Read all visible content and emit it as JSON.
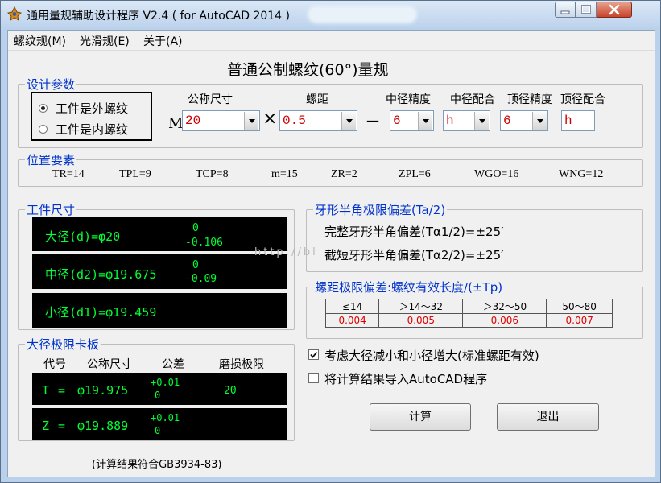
{
  "window": {
    "title": "通用量规辅助设计程序 V2.4 ( for AutoCAD 2014 )"
  },
  "menu": [
    "螺纹规(M)",
    "光滑规(E)",
    "关于(A)"
  ],
  "heading": "普通公制螺纹(60°)量规",
  "design": {
    "label": "设计参数",
    "radio_ext": "工件是外螺纹",
    "radio_int": "工件是内螺纹",
    "m_label": "M",
    "times": "×",
    "dash": "—",
    "nominal_label": "公称尺寸",
    "nominal": "20",
    "pitch_label": "螺距",
    "pitch": "0.5",
    "pd_acc_label": "中径精度",
    "pd_acc": "6",
    "pd_fit_label": "中径配合",
    "pd_fit": "h",
    "od_acc_label": "顶径精度",
    "od_acc": "6",
    "od_fit_label": "顶径配合",
    "od_fit": "h"
  },
  "position": {
    "label": "位置要素",
    "items": [
      "TR=14",
      "TPL=9",
      "TCP=8",
      "m=15",
      "ZR=2",
      "ZPL=6",
      "WGO=16",
      "WNG=12"
    ]
  },
  "workpiece": {
    "label": "工件尺寸",
    "major": {
      "text": "大径(d)=φ20",
      "upper": "0",
      "lower": "-0.106"
    },
    "pitch": {
      "text": "中径(d2)=φ19.675",
      "upper": "0",
      "lower": "-0.09"
    },
    "minor": {
      "text": "小径(d1)=φ19.459"
    }
  },
  "gauge": {
    "label": "大径极限卡板",
    "headers": [
      "代号",
      "公称尺寸",
      "公差",
      "磨损极限"
    ],
    "rows": [
      {
        "code": "T",
        "eq": "=",
        "size": "φ19.975",
        "upper": "+0.01",
        "lower": "0",
        "wear": "20"
      },
      {
        "code": "Z",
        "eq": "=",
        "size": "φ19.889",
        "upper": "+0.01",
        "lower": "0",
        "wear": ""
      }
    ]
  },
  "note": "(计算结果符合GB3934-83)",
  "halfangle": {
    "label": "牙形半角极限偏差(Ta/2)",
    "line1": "完整牙形半角偏差(Tα1/2)=±25′",
    "line2": "截短牙形半角偏差(Tα2/2)=±25′"
  },
  "pitchdev": {
    "label": "螺距极限偏差:螺纹有效长度/(±Tp)",
    "headers": [
      "≤14",
      "＞14～32",
      "＞32～50",
      "50～80"
    ],
    "values": [
      "0.004",
      "0.005",
      "0.006",
      "0.007"
    ]
  },
  "options": {
    "chk1": "考虑大径减小和小径增大(标准螺距有效)",
    "chk1_checked": true,
    "chk2": "将计算结果导入AutoCAD程序",
    "chk2_checked": false
  },
  "buttons": {
    "calc": "计算",
    "exit": "退出"
  },
  "watermark": "http://bl"
}
